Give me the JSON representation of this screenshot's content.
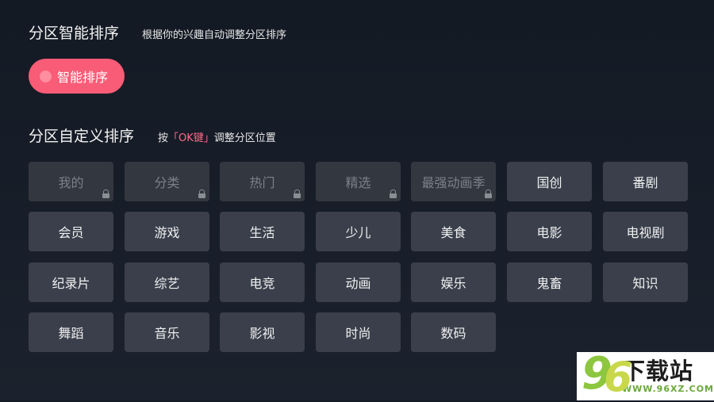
{
  "smart_section": {
    "title": "分区智能排序",
    "description": "根据你的兴趣自动调整分区排序",
    "toggle_label": "智能排序"
  },
  "custom_section": {
    "title": "分区自定义排序",
    "hint_prefix": "按",
    "hint_key": "「OK键」",
    "hint_suffix": "调整分区位置"
  },
  "tiles": [
    {
      "label": "我的",
      "locked": true
    },
    {
      "label": "分类",
      "locked": true
    },
    {
      "label": "热门",
      "locked": true
    },
    {
      "label": "精选",
      "locked": true
    },
    {
      "label": "最强动画季",
      "locked": true
    },
    {
      "label": "国创",
      "locked": false
    },
    {
      "label": "番剧",
      "locked": false
    },
    {
      "label": "会员",
      "locked": false
    },
    {
      "label": "游戏",
      "locked": false
    },
    {
      "label": "生活",
      "locked": false
    },
    {
      "label": "少儿",
      "locked": false
    },
    {
      "label": "美食",
      "locked": false
    },
    {
      "label": "电影",
      "locked": false
    },
    {
      "label": "电视剧",
      "locked": false
    },
    {
      "label": "纪录片",
      "locked": false
    },
    {
      "label": "综艺",
      "locked": false
    },
    {
      "label": "电竞",
      "locked": false
    },
    {
      "label": "动画",
      "locked": false
    },
    {
      "label": "娱乐",
      "locked": false
    },
    {
      "label": "鬼畜",
      "locked": false
    },
    {
      "label": "知识",
      "locked": false
    },
    {
      "label": "舞蹈",
      "locked": false
    },
    {
      "label": "音乐",
      "locked": false
    },
    {
      "label": "影视",
      "locked": false
    },
    {
      "label": "时尚",
      "locked": false
    },
    {
      "label": "数码",
      "locked": false
    }
  ],
  "watermark": {
    "logo_digits": [
      "9",
      "6"
    ],
    "title": "下载站",
    "url": "WWW.96XZ.COM"
  },
  "colors": {
    "accent": "#f95c76",
    "hint_highlight": "#ff6a8a",
    "tile_bg": "#3a3f4b",
    "tile_locked_bg": "#33373f"
  }
}
